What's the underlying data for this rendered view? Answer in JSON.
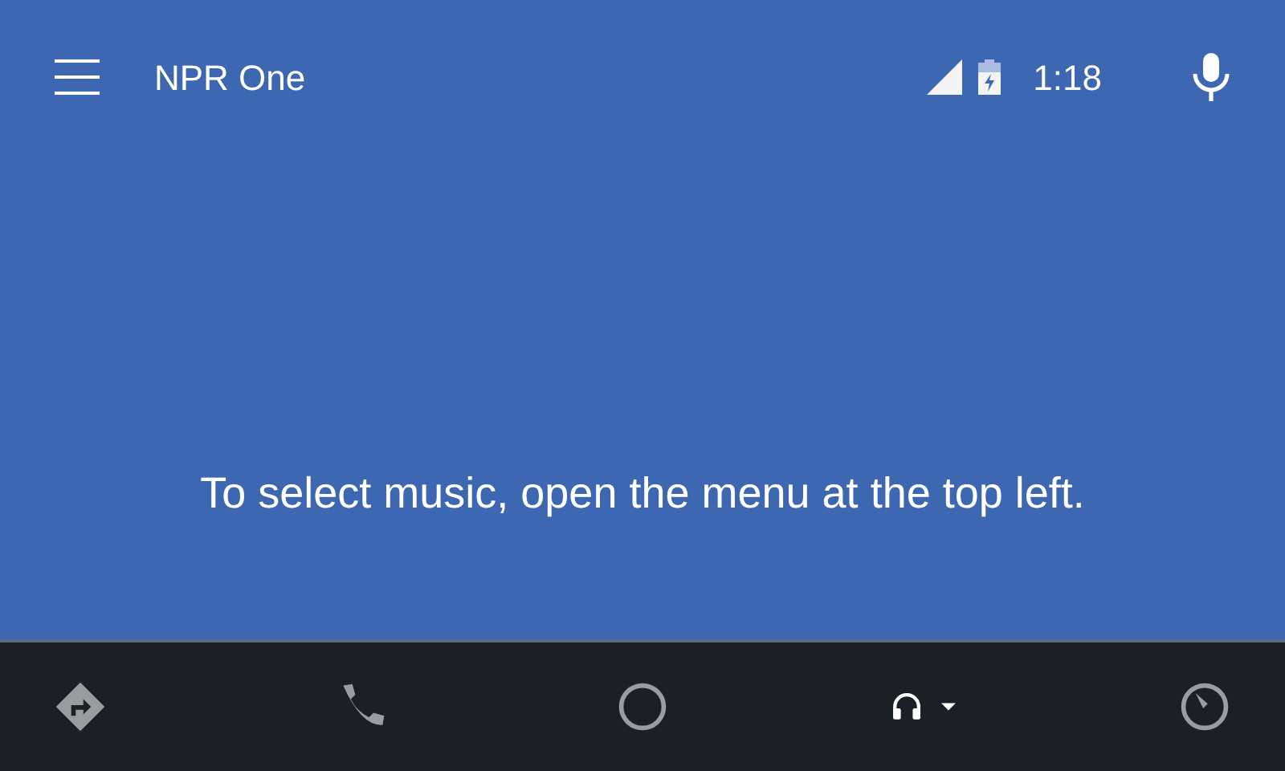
{
  "app_bar": {
    "title": "NPR One",
    "time": "1:18"
  },
  "message": "To select music, open the menu at the top left.",
  "nav_bar": [
    {
      "kind": "navigation",
      "selected": false
    },
    {
      "kind": "phone",
      "selected": false
    },
    {
      "kind": "home",
      "selected": false
    },
    {
      "kind": "audio",
      "selected": true
    },
    {
      "kind": "overview",
      "selected": false
    }
  ]
}
